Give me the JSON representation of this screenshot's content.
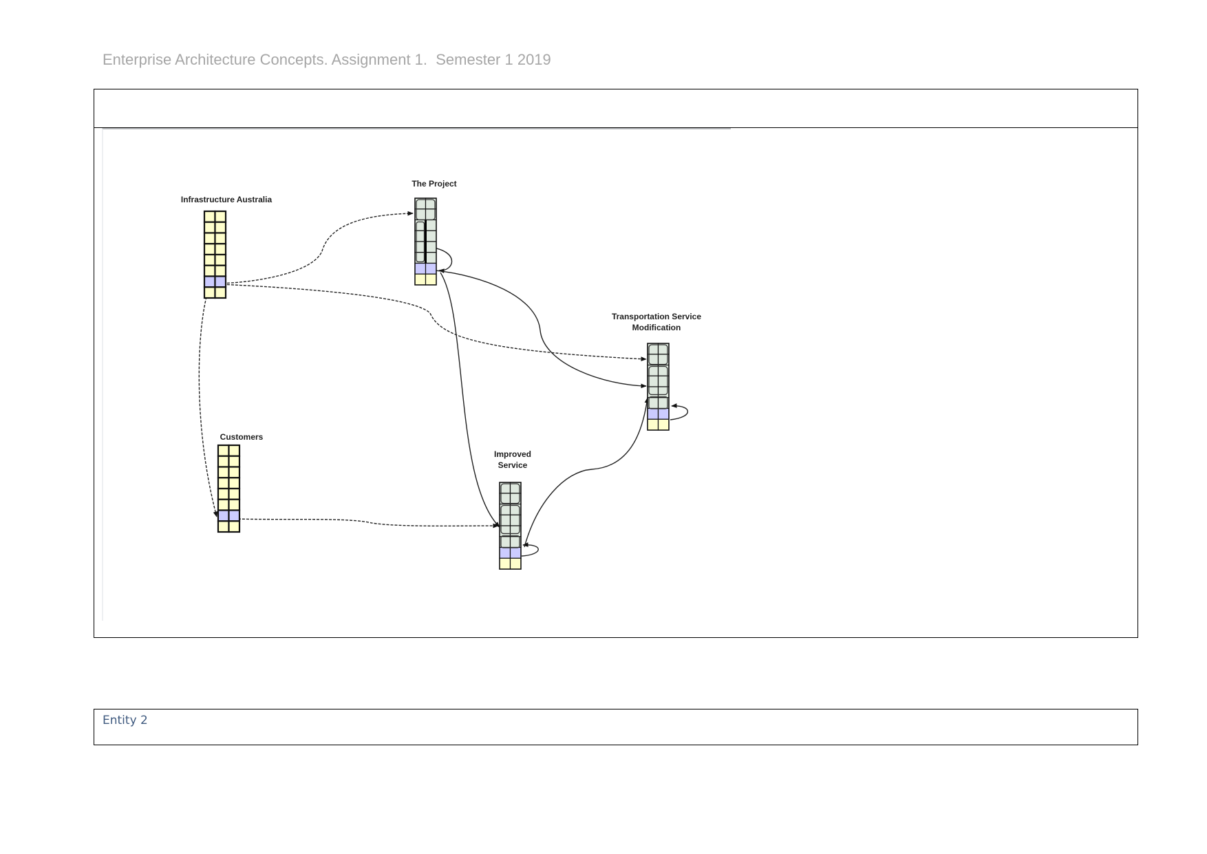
{
  "document": {
    "header_title": "Enterprise Architecture Concepts. Assignment 1.  Semester 1 2019",
    "entity_box_label": "Entity 2"
  },
  "diagram": {
    "colors": {
      "cell_default": "#ffffcc",
      "cell_highlight": "#ccccff",
      "cell_process": "#dfe9df",
      "border": "#111111",
      "edge": "#222222"
    },
    "nodes": [
      {
        "id": "infrastructure-australia",
        "label_lines": [
          "Infrastructure Australia"
        ],
        "rows": 8,
        "highlight_row": 7,
        "process_rows": []
      },
      {
        "id": "the-project",
        "label_lines": [
          "The Project"
        ],
        "rows": 8,
        "highlight_row": 7,
        "process_rows": [
          1,
          2,
          3,
          4,
          5,
          6
        ]
      },
      {
        "id": "transportation-service-modification",
        "label_lines": [
          "Transportation Service",
          "Modification"
        ],
        "rows": 8,
        "highlight_row": 7,
        "process_rows": [
          1,
          2,
          3,
          4,
          5,
          6
        ]
      },
      {
        "id": "customers",
        "label_lines": [
          "Customers"
        ],
        "rows": 8,
        "highlight_row": 7,
        "process_rows": []
      },
      {
        "id": "improved-service",
        "label_lines": [
          "Improved",
          "Service"
        ],
        "rows": 8,
        "highlight_row": 7,
        "process_rows": [
          1,
          2,
          3,
          4,
          5,
          6
        ]
      }
    ],
    "edges": [
      {
        "from": "infrastructure-australia",
        "to": "the-project",
        "style": "dashed"
      },
      {
        "from": "infrastructure-australia",
        "to": "transportation-service-modification",
        "style": "dashed"
      },
      {
        "from": "infrastructure-australia",
        "to": "customers",
        "style": "dashed"
      },
      {
        "from": "customers",
        "to": "improved-service",
        "style": "dashed"
      },
      {
        "from": "the-project",
        "to": "the-project",
        "style": "solid"
      },
      {
        "from": "the-project",
        "to": "transportation-service-modification",
        "style": "solid"
      },
      {
        "from": "the-project",
        "to": "improved-service",
        "style": "solid"
      },
      {
        "from": "improved-service",
        "to": "transportation-service-modification",
        "style": "solid"
      },
      {
        "from": "transportation-service-modification",
        "to": "transportation-service-modification",
        "style": "solid"
      },
      {
        "from": "improved-service",
        "to": "improved-service",
        "style": "solid"
      }
    ]
  }
}
